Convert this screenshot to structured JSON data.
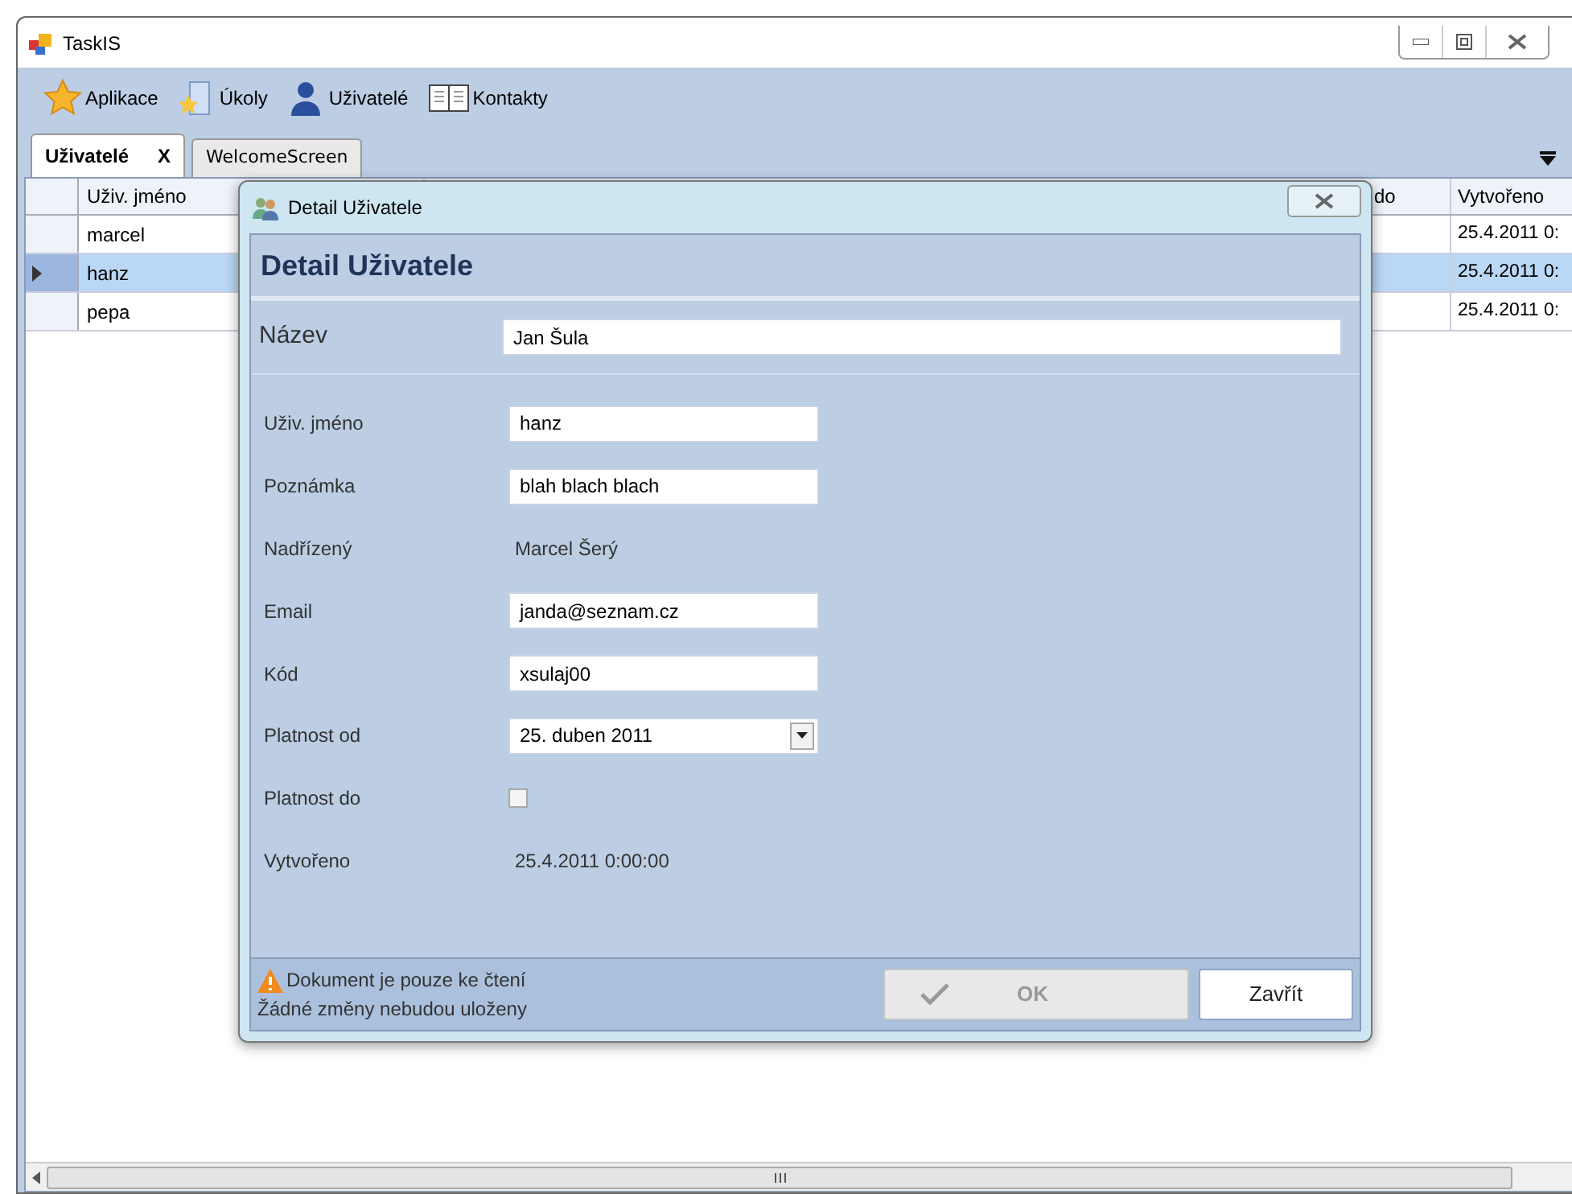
{
  "window": {
    "title": "TaskIS"
  },
  "toolbar": [
    {
      "label": "Aplikace"
    },
    {
      "label": "Úkoly"
    },
    {
      "label": "Uživatelé"
    },
    {
      "label": "Kontakty"
    }
  ],
  "tabs": [
    {
      "label": "Uživatelé",
      "selected": true,
      "close": "X"
    },
    {
      "label": "WelcomeScreen",
      "selected": false
    }
  ],
  "grid": {
    "columns": [
      "Uživ. jméno",
      "do",
      "Vytvořeno"
    ],
    "rows": [
      {
        "cells": [
          "marcel",
          "",
          "25.4.2011 0:"
        ],
        "selected": false
      },
      {
        "cells": [
          "hanz",
          "",
          "25.4.2011 0:"
        ],
        "selected": true
      },
      {
        "cells": [
          "pepa",
          "",
          "25.4.2011 0:"
        ],
        "selected": false
      }
    ]
  },
  "dialog": {
    "title": "Detail Uživatele",
    "heading": "Detail Uživatele",
    "name_label": "Název",
    "name_value": "Jan Šula",
    "fields": [
      {
        "kind": "text",
        "label": "Uživ. jméno",
        "value": "hanz"
      },
      {
        "kind": "text",
        "label": "Poznámka",
        "value": "blah blach blach"
      },
      {
        "kind": "static",
        "label": "Nadřízený",
        "value": "Marcel Šerý"
      },
      {
        "kind": "text",
        "label": "Email",
        "value": "janda@seznam.cz"
      },
      {
        "kind": "text",
        "label": "Kód",
        "value": "xsulaj00"
      },
      {
        "kind": "date",
        "label": "Platnost od",
        "value": "25. duben 2011"
      },
      {
        "kind": "checkbox",
        "label": "Platnost do",
        "checked": false
      },
      {
        "kind": "static",
        "label": "Vytvořeno",
        "value": "25.4.2011 0:00:00"
      }
    ],
    "notice": [
      "Dokument je pouze ke čtení",
      "Žádné změny nebudou uloženy"
    ],
    "buttons": [
      {
        "label": "OK",
        "disabled": true
      },
      {
        "label": "Zavřít",
        "disabled": false
      }
    ]
  }
}
